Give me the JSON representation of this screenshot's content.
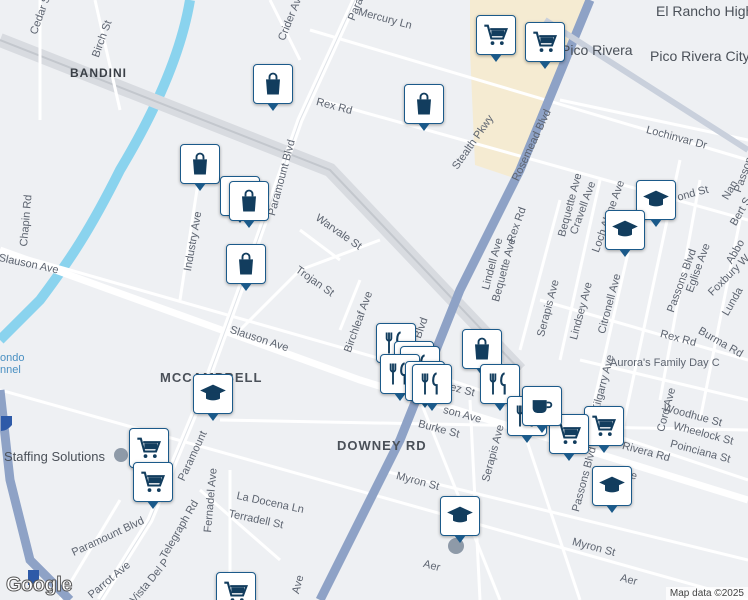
{
  "map": {
    "attribution": "Map data ©2025",
    "logo": "Google",
    "colors": {
      "background": "#eef0f3",
      "road": "#ffffff",
      "highway": "#8ea2c6",
      "river": "#8ad3ee",
      "commercial": "#f5ebd2",
      "pin_border": "#1b5a8a",
      "pin_icon": "#123d5e"
    }
  },
  "labels": {
    "cedar_st": "Cedar St",
    "birch_st": "Birch St",
    "crider_ave": "Crider Ave",
    "paramount_blvd_top": "Paramount Blvd",
    "mercury_ln": "Mercury Ln",
    "el_rancho": "El Rancho High",
    "pico_rivera": "Pico Rivera",
    "pico_rivera_city": "Pico Rivera City",
    "bandini": "BANDINI",
    "rex_rd": "Rex Rd",
    "stealth_pkwy": "Stealth Pkwy",
    "rosemead_blvd": "Rosemead Blvd",
    "lochinvar_dr": "Lochinvar Dr",
    "chapin_rd": "Chapin Rd",
    "paramount_blvd": "Paramount Blvd",
    "industry_ave": "Industry Ave",
    "warvale_st": "Warvale St",
    "trojan_st": "Trojan St",
    "slauson_ave_w": "Slauson Ave",
    "slauson_ave": "Slauson Ave",
    "birchleaf_ave": "Birchleaf Ave",
    "rex_rd_e": "Rex Rd",
    "lindell_ave": "Lindell Ave",
    "bequette_ave": "Bequette Ave",
    "bequette_ave_n": "Bequette Ave",
    "serapis_ave": "Serapis Ave",
    "crawell_ave": "Cravell Ave",
    "loch_alene_ave": "Loch Alene Ave",
    "lindsey_ave": "Lindsey Ave",
    "citronell_ave": "Citronell Ave",
    "passons_blvd": "Passons Blvd",
    "passons_blvd_n": "Passons Blvd",
    "rex_rd_far": "Rex Rd",
    "burma_rd": "Burma Rd",
    "aurora": "Aurora's Family Day C",
    "mccampbell": "MCCAMPBELL",
    "kilgarry_ave": "Kilgarry Ave",
    "woodhue_st": "Woodhue St",
    "wheelock_st": "Wheelock St",
    "poinciana_st": "Poinciana St",
    "rivera_rd": "Rivera Rd",
    "cord_ave": "Cord Ave",
    "downey_rd": "DOWNEY RD",
    "burke_st": "Burke St",
    "serapis_ave_s": "Serapis Ave",
    "passons_blvd_s": "Passons Blvd",
    "staffing": "Staffing Solutions",
    "telegraph_rd": "Telegraph Rd",
    "paramount_blvd_s": "Paramount Blvd",
    "paramount_short": "Paramount",
    "fernadel_ave": "Fernadel Ave",
    "la_docena_ln": "La Docena Ln",
    "terradell_st": "Terradell St",
    "myron_st": "Myron St",
    "myron_st_e": "Myron St",
    "parrot_ave": "Parrot Ave",
    "vista_del": "Vista Del P",
    "ave_s": "Ave",
    "eglise_ave": "Eglise Ave",
    "foxbury": "Foxbury W",
    "abbo": "Abbo",
    "bert": "Bert S",
    "lunda": "Lunda",
    "nan": "Nan",
    "passons_top": "Passons Blvd",
    "ond": "ond St",
    "ndez": "ndez St",
    "son_ave": "son Ave",
    "n_ave": "n Ave",
    "rondo": "ondo",
    "nnel": "nnel",
    "blvd_partial": "Blvd",
    "aer": "Aer",
    "aer2": "Aer",
    "i5": "5"
  },
  "pins": [
    {
      "type": "shopping-bag"
    },
    {
      "type": "shopping-bag"
    },
    {
      "type": "shopping-bag"
    },
    {
      "type": "shopping-bag"
    },
    {
      "type": "shopping-bag"
    },
    {
      "type": "shopping-bag"
    },
    {
      "type": "shopping-bag"
    },
    {
      "type": "shopping-cart"
    },
    {
      "type": "shopping-cart"
    },
    {
      "type": "shopping-cart"
    },
    {
      "type": "shopping-cart"
    },
    {
      "type": "shopping-cart"
    },
    {
      "type": "shopping-cart"
    },
    {
      "type": "shopping-cart"
    },
    {
      "type": "restaurant"
    },
    {
      "type": "restaurant"
    },
    {
      "type": "restaurant"
    },
    {
      "type": "restaurant"
    },
    {
      "type": "restaurant"
    },
    {
      "type": "restaurant"
    },
    {
      "type": "restaurant"
    },
    {
      "type": "restaurant"
    },
    {
      "type": "cafe"
    },
    {
      "type": "school"
    },
    {
      "type": "school"
    },
    {
      "type": "school"
    },
    {
      "type": "school"
    },
    {
      "type": "school"
    }
  ]
}
